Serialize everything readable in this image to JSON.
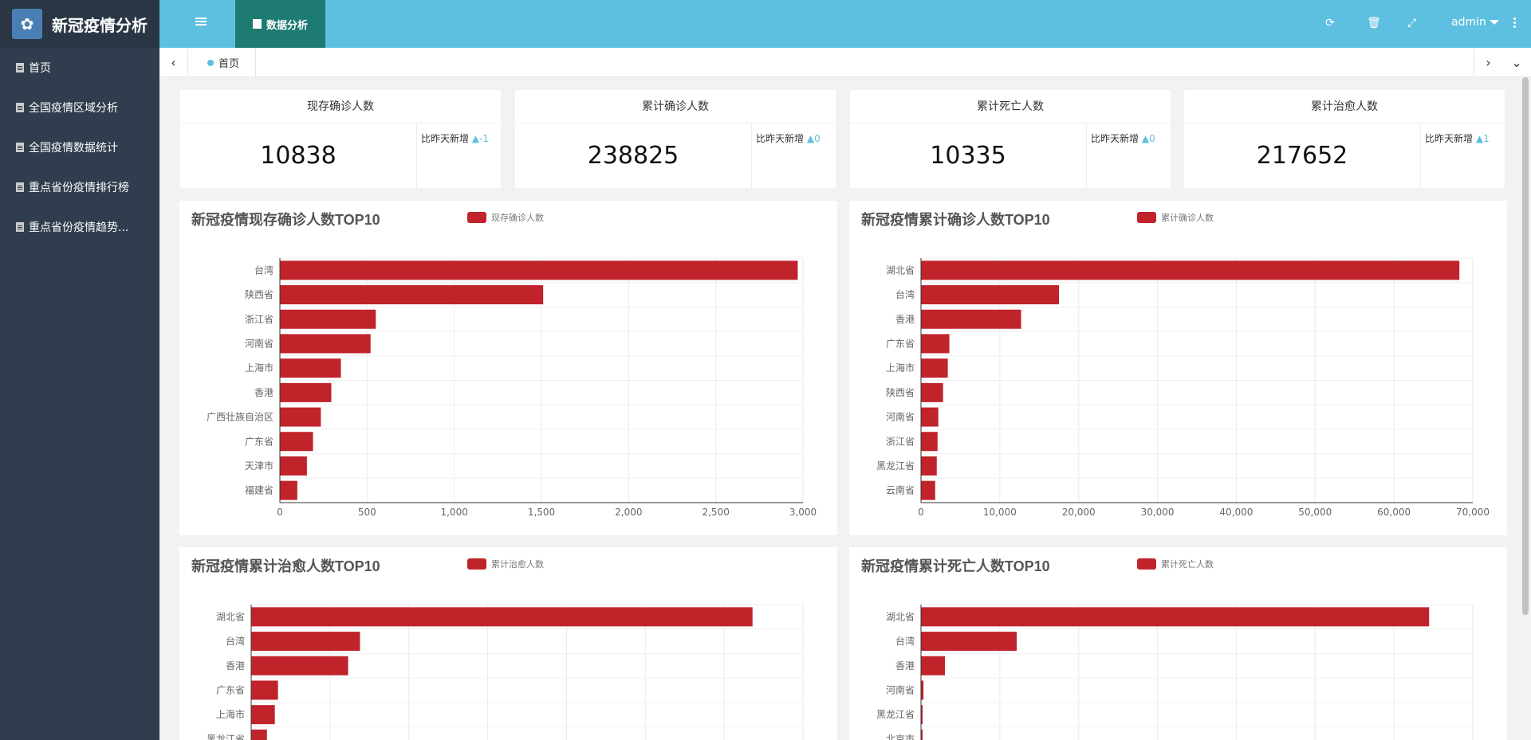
{
  "app": {
    "title": "新冠疫情分析",
    "logo_icon": "python-icon"
  },
  "sidebar": {
    "items": [
      {
        "label": "首页"
      },
      {
        "label": "全国疫情区域分析"
      },
      {
        "label": "全国疫情数据统计"
      },
      {
        "label": "重点省份疫情排行榜"
      },
      {
        "label": "重点省份疫情趋势..."
      }
    ]
  },
  "header": {
    "active_tab": "数据分析",
    "user": "admin"
  },
  "tabbar": {
    "home": "首页"
  },
  "stats": [
    {
      "title": "现存确诊人数",
      "value": "10838",
      "delta_label": "比昨天新增",
      "delta": "▲-1"
    },
    {
      "title": "累计确诊人数",
      "value": "238825",
      "delta_label": "比昨天新增",
      "delta": "▲0"
    },
    {
      "title": "累计死亡人数",
      "value": "10335",
      "delta_label": "比昨天新增",
      "delta": "▲0"
    },
    {
      "title": "累计治愈人数",
      "value": "217652",
      "delta_label": "比昨天新增",
      "delta": "▲1"
    }
  ],
  "colors": {
    "bar": "#c1232b",
    "accent": "#5ec0e0"
  },
  "chart_data": [
    {
      "type": "bar",
      "title": "新冠疫情现存确诊人数TOP10",
      "legend": "现存确诊人数",
      "categories": [
        "台湾",
        "陕西省",
        "浙江省",
        "河南省",
        "上海市",
        "香港",
        "广西壮族自治区",
        "广东省",
        "天津市",
        "福建省"
      ],
      "values": [
        2970,
        1510,
        550,
        520,
        350,
        295,
        235,
        190,
        155,
        100
      ],
      "ticks": [
        0,
        500,
        1000,
        1500,
        2000,
        2500,
        3000
      ],
      "tick_labels": [
        "0",
        "500",
        "1,000",
        "1,500",
        "2,000",
        "2,500",
        "3,000"
      ],
      "xlim": [
        0,
        3000
      ]
    },
    {
      "type": "bar",
      "title": "新冠疫情累计确诊人数TOP10",
      "legend": "累计确诊人数",
      "categories": [
        "湖北省",
        "台湾",
        "香港",
        "广东省",
        "上海市",
        "陕西省",
        "河南省",
        "浙江省",
        "黑龙江省",
        "云南省"
      ],
      "values": [
        68300,
        17500,
        12700,
        3600,
        3400,
        2800,
        2200,
        2100,
        2000,
        1800
      ],
      "ticks": [
        0,
        10000,
        20000,
        30000,
        40000,
        50000,
        60000,
        70000
      ],
      "tick_labels": [
        "0",
        "10,000",
        "20,000",
        "30,000",
        "40,000",
        "50,000",
        "60,000",
        "70,000"
      ],
      "xlim": [
        0,
        70000
      ]
    },
    {
      "type": "bar",
      "title": "新冠疫情累计治愈人数TOP10",
      "legend": "累计治愈人数",
      "categories": [
        "湖北省",
        "台湾",
        "香港",
        "广东省",
        "上海市",
        "黑龙江省"
      ],
      "values": [
        63600,
        13800,
        12300,
        3400,
        3000,
        2000
      ],
      "ticks": [
        0,
        10000,
        20000,
        30000,
        40000,
        50000,
        60000,
        70000
      ],
      "xlim": [
        0,
        70000
      ]
    },
    {
      "type": "bar",
      "title": "新冠疫情累计死亡人数TOP10",
      "legend": "累计死亡人数",
      "categories": [
        "湖北省",
        "台湾",
        "香港",
        "河南省",
        "黑龙江省",
        "北京市"
      ],
      "values": [
        4512,
        850,
        213,
        22,
        13,
        9
      ],
      "ticks": [
        0,
        700,
        1400,
        2100,
        2800,
        3500,
        4200,
        4900
      ],
      "xlim": [
        0,
        4900
      ]
    }
  ]
}
